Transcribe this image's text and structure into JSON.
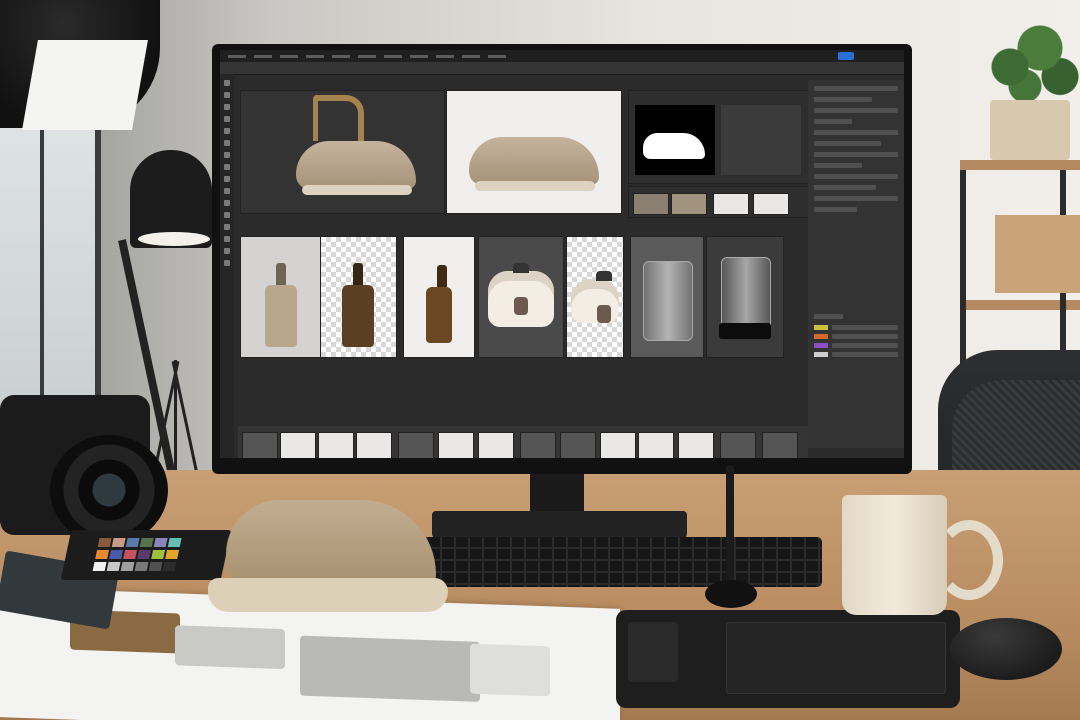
{
  "scene": {
    "description_type": "photo of product-photo editing workstation"
  },
  "editor": {
    "panels": {
      "canvas_tiles": [
        {
          "kind": "shoe-studio-dark"
        },
        {
          "kind": "shoe-white-bg"
        },
        {
          "kind": "shoe-mask"
        }
      ],
      "product_tiles": [
        {
          "kind": "dropper-bottle-grey-bg"
        },
        {
          "kind": "dropper-bottle-transparent"
        },
        {
          "kind": "dropper-bottle-white"
        },
        {
          "kind": "rice-cooker-dark-bg"
        },
        {
          "kind": "rice-cooker-transparent"
        },
        {
          "kind": "glass-jar-dark"
        },
        {
          "kind": "glass-jar-black-lid"
        }
      ],
      "filmstrip_count": 14
    },
    "accent_color": "#2a6fd6"
  },
  "desk_objects": [
    {
      "name": "camera"
    },
    {
      "name": "color-checker-palette"
    },
    {
      "name": "sneaker"
    },
    {
      "name": "keyboard"
    },
    {
      "name": "coffee-mug"
    },
    {
      "name": "drawing-tablet"
    },
    {
      "name": "stylus-pen"
    },
    {
      "name": "mouse"
    },
    {
      "name": "printed-proofs"
    }
  ]
}
